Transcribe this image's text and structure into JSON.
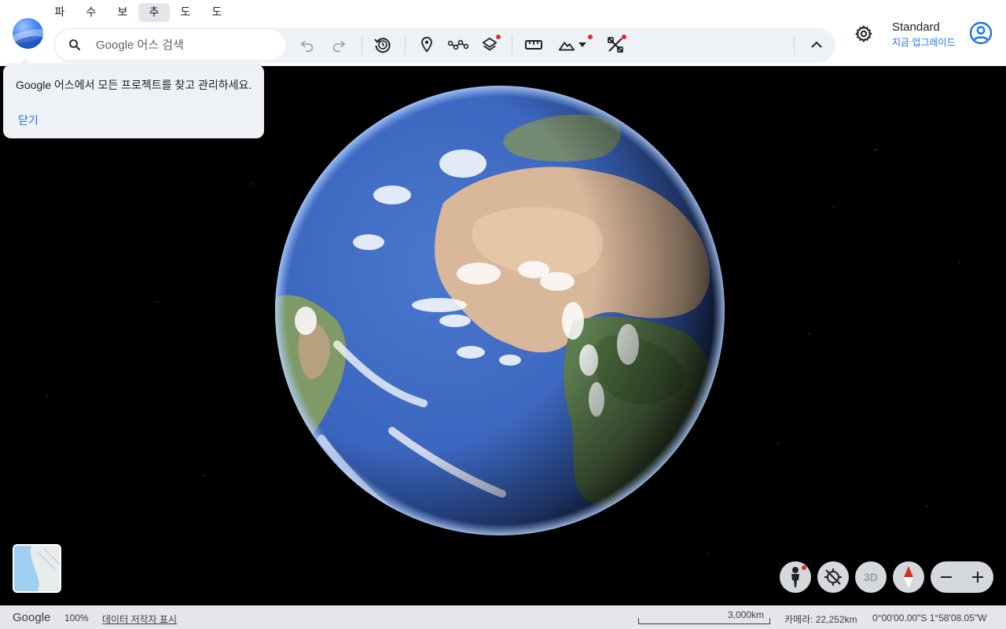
{
  "menu": {
    "items": [
      "파",
      "수",
      "보",
      "추",
      "도",
      "도"
    ],
    "active_index": 3
  },
  "search": {
    "placeholder": "Google 어스 검색",
    "value": ""
  },
  "toolbar": {
    "icons": [
      "undo-icon",
      "redo-icon",
      "historical-imagery-icon",
      "add-placemark-icon",
      "draw-path-icon",
      "layers-icon",
      "measure-icon",
      "map-style-icon",
      "tools-icon",
      "collapse-icon"
    ],
    "badges": [
      "layers",
      "map-style",
      "tools"
    ],
    "badge_color": "#d93025"
  },
  "account": {
    "plan": "Standard",
    "upgrade_label": "지금 업그레이드"
  },
  "tooltip": {
    "message": "Google 어스에서 모든 프로젝트를 찾고 관리하세요.",
    "close_label": "닫기"
  },
  "controls": {
    "three_d_label": "3D",
    "pegman_badge": true
  },
  "status": {
    "brand": "Google",
    "zoom": "100%",
    "credits": "데이터 저작자 표시",
    "scale": "3,000km",
    "camera": "카메라: 22,252km",
    "coords": "0°00'00.00\"S 1°58'08.05\"W"
  },
  "colors": {
    "accent": "#1a73e8",
    "toolbar_bg": "#eef2f7",
    "ocean": "#3d6bc9"
  }
}
